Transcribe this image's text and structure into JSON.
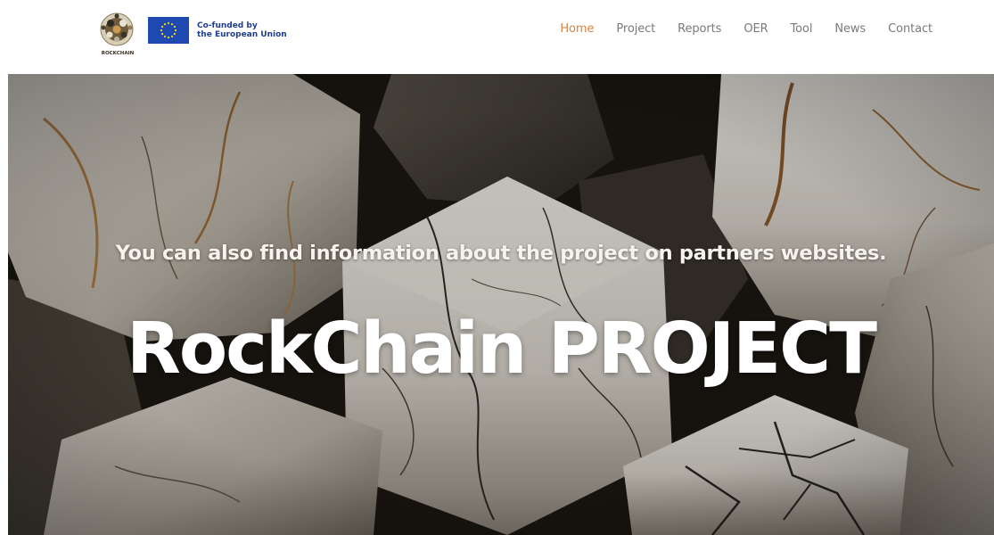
{
  "header": {
    "logo": {
      "icon": "rockchain-logo-icon",
      "text": "ROCKCHAIN"
    },
    "eu_badge": {
      "icon": "eu-flag-icon",
      "line1": "Co-funded by",
      "line2": "the European Union"
    }
  },
  "nav": {
    "items": [
      {
        "label": "Home",
        "active": true
      },
      {
        "label": "Project",
        "active": false
      },
      {
        "label": "Reports",
        "active": false
      },
      {
        "label": "OER",
        "active": false
      },
      {
        "label": "Tool",
        "active": false
      },
      {
        "label": "News",
        "active": false
      },
      {
        "label": "Contact",
        "active": false
      }
    ]
  },
  "hero": {
    "subtitle": "You can also find information about the project on partners websites.",
    "title": "RockChain PROJECT"
  },
  "colors": {
    "nav_active": "#d58547",
    "nav_default": "#7a7a7a",
    "eu_blue": "#1d3d8f",
    "eu_yellow": "#ffdd00",
    "hero_text": "#ffffff"
  }
}
